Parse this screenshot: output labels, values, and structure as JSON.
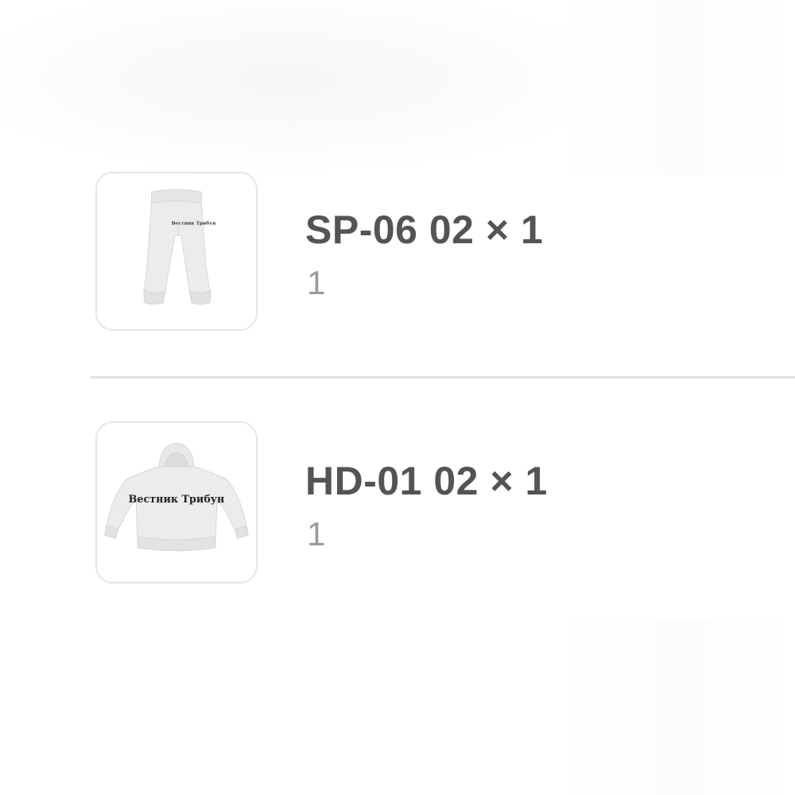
{
  "order_items": [
    {
      "title": "SP-06 02 × 1",
      "quantity": "1",
      "image": {
        "icon": "sweatpants-product-image",
        "print_text": "Вестник Трибун"
      }
    },
    {
      "title": "HD-01 02 × 1",
      "quantity": "1",
      "image": {
        "icon": "hoodie-product-image",
        "print_text": "Вестник Трибун"
      }
    }
  ],
  "colors": {
    "title": "#545454",
    "quantity": "#9a9a9a",
    "divider": "#e4e4e4",
    "thumbnail_border": "#e6e6e6",
    "garment": "#ececec"
  }
}
